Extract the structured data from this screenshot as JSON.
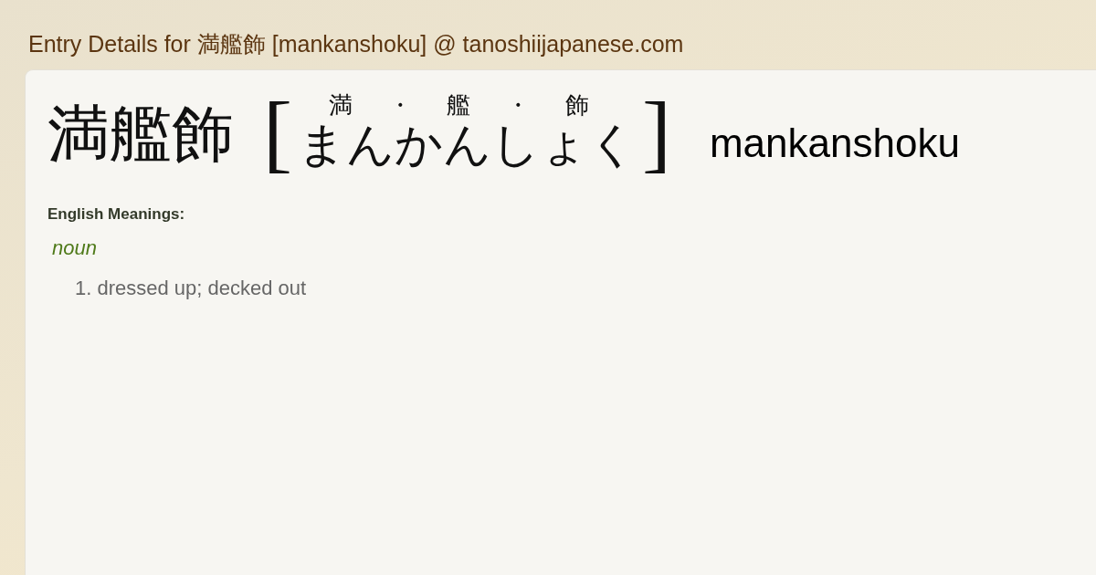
{
  "page_title": "Entry Details for 満艦飾 [mankanshoku] @ tanoshiijapanese.com",
  "entry": {
    "kanji": "満艦飾",
    "bracket_open": "[",
    "bracket_close": "]",
    "furigana": [
      "満",
      "・",
      "艦",
      "・",
      "飾"
    ],
    "kana": "まんかんしょく",
    "romaji": "mankanshoku"
  },
  "meanings": {
    "heading": "English Meanings:",
    "groups": [
      {
        "pos": "noun",
        "senses": [
          {
            "number": "1.",
            "text": "dressed up; decked out"
          }
        ]
      }
    ]
  }
}
